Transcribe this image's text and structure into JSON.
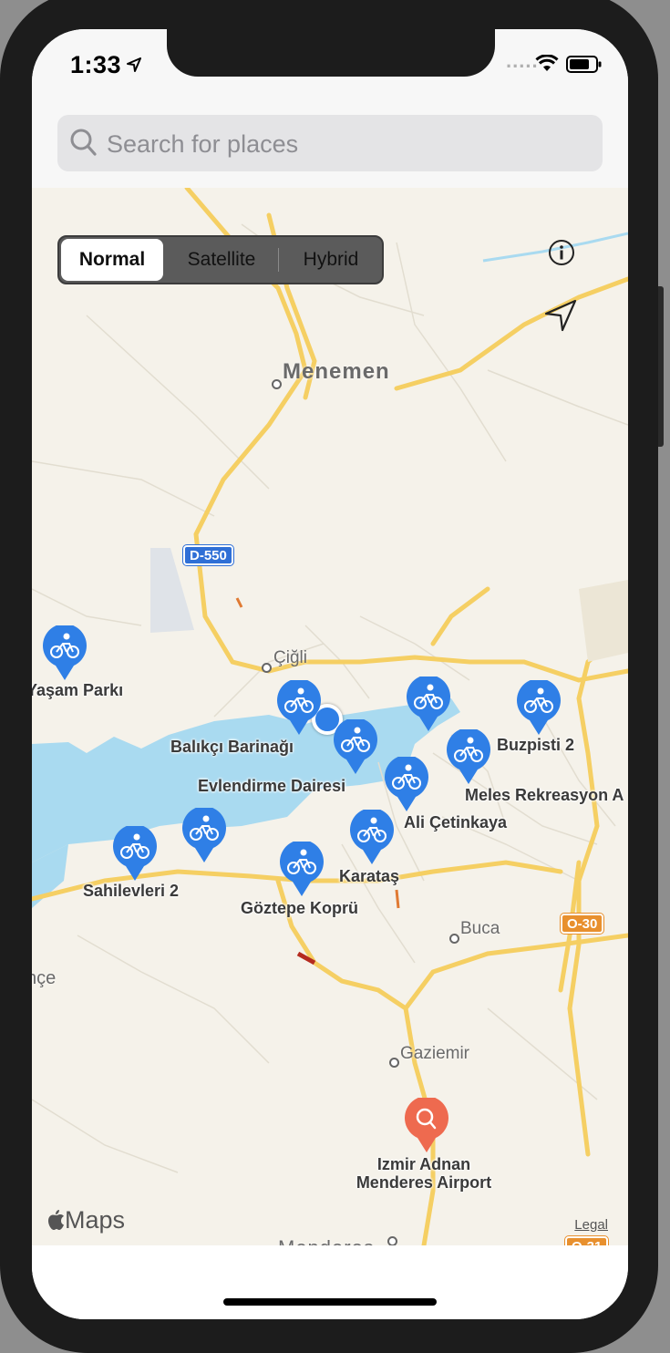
{
  "status_bar": {
    "time": "1:33",
    "signal": "....."
  },
  "search": {
    "placeholder": "Search for places"
  },
  "map_type_control": {
    "options": [
      "Normal",
      "Satellite",
      "Hybrid"
    ],
    "selected": "Normal"
  },
  "map": {
    "towns": [
      "Menemen",
      "Çiğli",
      "Buca",
      "Gaziemir",
      "Menderes",
      "nçe"
    ],
    "highway_shields": [
      "D-550",
      "O-30",
      "O-31"
    ],
    "bike_stations": [
      "Yaşam Parkı",
      "Balıkçı Barinağı",
      "Evlendirme Dairesi",
      "Buzpisti 2",
      "Meles Rekreasyon A",
      "Ali Çetinkaya",
      "Karataş",
      "Göztepe Koprü",
      "Sahilevleri 2"
    ],
    "search_result": {
      "line1": "Izmir Adnan",
      "line2": "Menderes Airport"
    },
    "attribution": {
      "brand": "Maps",
      "legal": "Legal"
    }
  },
  "colors": {
    "pin_blue": "#2f7fe6",
    "search_pin": "#ee6a4f",
    "water": "#a9daf0",
    "road": "#f5cf63",
    "land": "#f5f2ea"
  },
  "icons": [
    "location-arrow-icon",
    "wifi-icon",
    "battery-icon",
    "search-icon",
    "info-icon",
    "navigation-arrow-icon",
    "bicycle-icon",
    "apple-logo-icon"
  ]
}
